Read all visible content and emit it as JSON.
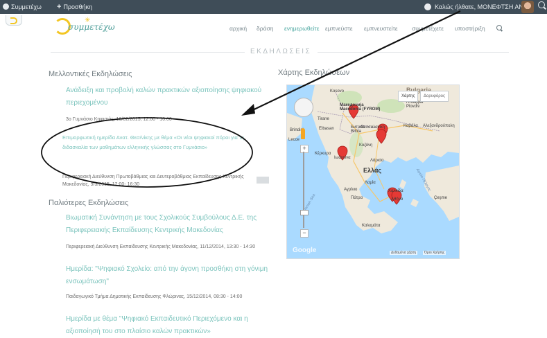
{
  "admin_bar": {
    "site_label": "Συμμετέχω",
    "new_label": "Προσθήκη",
    "greeting": "Καλώς ήλθατε, ΜΟΝΕΦΤΣΗ ΑΝΝΑ"
  },
  "header": {
    "logo_text": "συμμετέχω",
    "nav": [
      {
        "label": "αρχική",
        "active": false
      },
      {
        "label": "δράση",
        "active": false
      },
      {
        "label": "ενημερωθείτε",
        "active": true
      },
      {
        "label": "εμπνεύστε",
        "active": false
      },
      {
        "label": "εμπνευστείτε",
        "active": false
      },
      {
        "label": "συμμετέχετε",
        "active": false
      },
      {
        "label": "υποστήριξη",
        "active": false
      }
    ]
  },
  "section_title": "ΕΚΔΗΛΩΣΕΙΣ",
  "upcoming": {
    "heading": "Μελλοντικές Εκδηλώσεις",
    "events": [
      {
        "title": "Ανάδειξη και προβολή καλών πρακτικών αξιοποίησης ψηφιακού περιεχομένου",
        "meta": "3ο Γυμνάσιο Κηφισιάς, 16/02/2015, 12:00 - 16:00"
      },
      {
        "title": "Επιμορφωτική ημερίδα Ανατ. Θεσ/νίκης με θέμα «Οι νέοι ψηφιακοί πόροι για τη διδασκαλία των μαθημάτων ελληνικής γλώσσας στο Γυμνάσιο»",
        "meta": "Περιφερειακή Διεύθυνση Πρωτοβάθμιας και Δευτεροβάθμιας Εκπαίδευσης Κεντρικής Μακεδονίας, 9/3/2015, 12:00- 16:30"
      }
    ]
  },
  "past": {
    "heading": "Παλιότερες Εκδηλώσεις",
    "events": [
      {
        "title": "Βιωματική Συνάντηση με τους Σχολικούς Συμβούλους Δ.Ε. της Περιφερειακής Εκπαίδευσης Κεντρικής Μακεδονίας",
        "meta": "Περιφερειακή Διεύθυνση Εκπαίδευσης Κεντρικής Μακεδονίας, 11/12/2014, 13:30 - 14:30"
      },
      {
        "title": "Ημερίδα: \"Ψηφιακό Σχολείο: από την άγονη προσθήκη στη γόνιμη ενσωμάτωση\"",
        "meta": "Παιδαγωγικό Τμήμα Δημοτικής Εκπαίδευσης Φλώρινας, 15/12/2014, 08:30 - 14:00"
      },
      {
        "title": "Ημερίδα με θέμα \"Ψηφιακό Εκπαιδευτικό Περιεχόμενο και η αξιοποίησή του στο πλαίσιο καλών πρακτικών»"
      }
    ]
  },
  "map": {
    "title": "Χάρτης Εκδηλώσεων",
    "type_map": "Χάρτης",
    "type_satellite": "Δορυφόρος",
    "brand": "Google",
    "data_attr": "Δεδομένα χάρτη",
    "terms": "Όροι Χρήσης",
    "places": {
      "kosovo": "Kosovo",
      "macedonia": "Македонија Macedonia (FYROM)",
      "bulgaria": "Bulgaria",
      "plovdiv": "Пловдив Plovdiv",
      "tirana": "Tirane",
      "bitola": "Битола Bitola",
      "thessaloniki": "Θεσσαλονίκη",
      "elbasan": "Elbasan",
      "kozani": "Κοζάνη",
      "brindisi": "Brindisi",
      "lecce": "Lecce",
      "ioannina": "Ιωάννινα",
      "kerkyra": "Κέρκυρα",
      "ellas": "Ελλάς",
      "larisa": "Λάρισα",
      "lamia": "Λαμία",
      "agrinio": "Αγρίνιο",
      "patra": "Πάτρα",
      "athina": "Αθήνα",
      "chalkida": "Χαλκίδα",
      "kalamata": "Καλαμάτα",
      "aegean": "Αιγαίο Πέλαγος",
      "ionian": "Ionian Sea",
      "kavala": "Καβάλα",
      "alexandroupoli": "Αλεξανδρούπολη",
      "cesme": "Çeşme"
    }
  },
  "colors": {
    "admin_bar": "#3f4d58",
    "link": "#7cc4bd",
    "nav_active": "#4ba7a0",
    "marker": "#e53935",
    "sea": "#aadaff",
    "land": "#f0ede5"
  }
}
